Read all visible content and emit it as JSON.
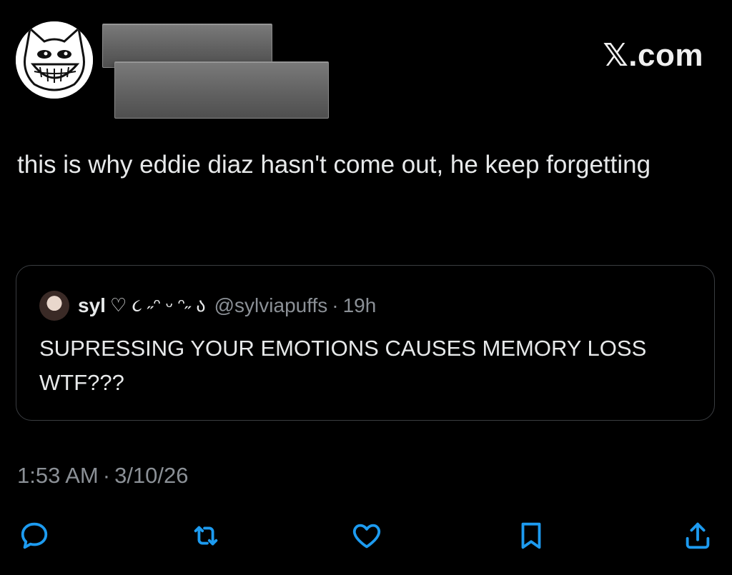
{
  "header": {
    "brand": "𝕏.com",
    "avatar_icon": "grinning-cat-avatar-icon"
  },
  "tweet": {
    "text": "this is why eddie diaz hasn't come out, he keep forgetting",
    "time": "1:53 AM",
    "separator": "·",
    "date": "3/10/26"
  },
  "quote": {
    "name": "syl",
    "decoration": "♡ ૮ ˶ᵔ ᵕ ᵔ˶ ა",
    "handle": "@sylviapuffs",
    "separator": "·",
    "time": "19h",
    "text": "SUPRESSING YOUR EMOTIONS CAUSES MEMORY LOSS WTF???"
  },
  "actions": {
    "icons": [
      "reply-icon",
      "repost-icon",
      "like-icon",
      "bookmark-icon",
      "share-icon"
    ],
    "icon_color": "#1d9bf0"
  },
  "colors": {
    "background": "#000000",
    "text": "#e7e9ea",
    "muted": "#8b9096",
    "accent": "#1d9bf0",
    "border": "#3a3d41"
  }
}
